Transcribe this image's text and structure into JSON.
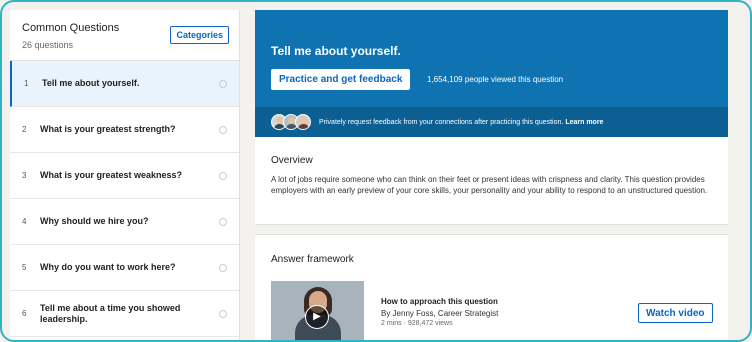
{
  "sidebar": {
    "title": "Common Questions",
    "count": "26 questions",
    "categories_label": "Categories",
    "questions": [
      {
        "num": "1",
        "text": "Tell me about yourself."
      },
      {
        "num": "2",
        "text": "What is your greatest strength?"
      },
      {
        "num": "3",
        "text": "What is your greatest weakness?"
      },
      {
        "num": "4",
        "text": "Why should we hire you?"
      },
      {
        "num": "5",
        "text": "Why do you want to work here?"
      },
      {
        "num": "6",
        "text": "Tell me about a time you showed leadership."
      }
    ]
  },
  "hero": {
    "title": "Tell me about yourself.",
    "practice_label": "Practice and get feedback",
    "views": "1,654,109 people viewed this question",
    "feedback_text": "Privately request feedback from your connections after practicing this question.",
    "learn_more": "Learn more",
    "color": "#0e73b0"
  },
  "overview": {
    "title": "Overview",
    "body": "A lot of jobs require someone who can think on their feet or present ideas with crispness and clarity. This question provides employers with an early preview of your core skills, your personality and your ability to respond to an unstructured question."
  },
  "framework": {
    "title": "Answer framework",
    "video_title": "How to approach this question",
    "video_author": "By Jenny Foss, Career Strategist",
    "video_meta": "2 mins · 928,472 views",
    "watch_label": "Watch video"
  }
}
